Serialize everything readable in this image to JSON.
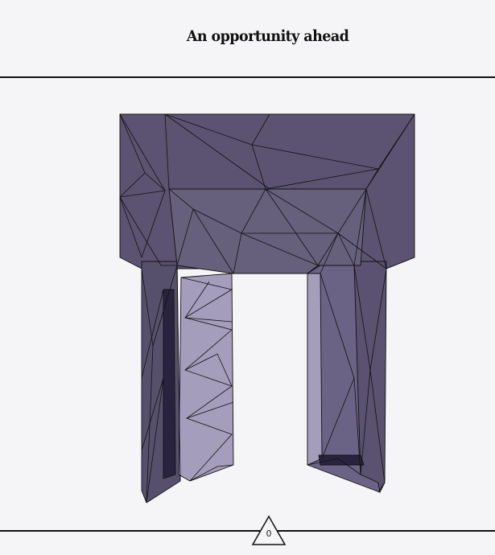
{
  "title": "An opportunity ahead",
  "counter": {
    "value": "0"
  },
  "colors": {
    "background": "#f5f4f6",
    "model_main": "#5c5372",
    "model_light": "#a59dbc",
    "model_dark": "#2a2340",
    "edges": "#111111"
  }
}
